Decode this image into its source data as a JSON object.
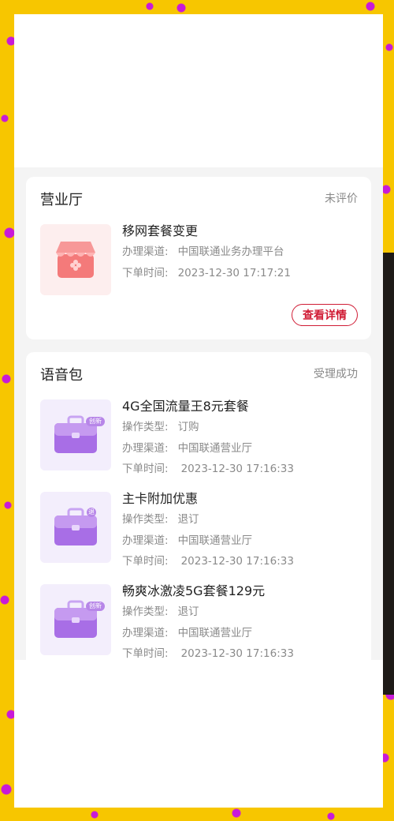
{
  "cards": [
    {
      "title": "营业厅",
      "status": "未评价",
      "item": {
        "icon": "store-icon",
        "name": "移网套餐变更",
        "channel_label": "办理渠道:",
        "channel_value": "中国联通业务办理平台",
        "time_label": "下单时间:",
        "time_value": "2023-12-30 17:17:21"
      },
      "detail_button": "查看详情"
    },
    {
      "title": "语音包",
      "status": "受理成功",
      "items": [
        {
          "icon": "briefcase-icon",
          "badge": "创新",
          "name": "4G全国流量王8元套餐",
          "op_label": "操作类型:",
          "op_value": "订购",
          "channel_label": "办理渠道:",
          "channel_value": "中国联通营业厅",
          "time_label": "下单时间:",
          "time_value": "2023-12-30 17:16:33"
        },
        {
          "icon": "briefcase-icon",
          "badge": "退",
          "name": "主卡附加优惠",
          "op_label": "操作类型:",
          "op_value": "退订",
          "channel_label": "办理渠道:",
          "channel_value": "中国联通营业厅",
          "time_label": "下单时间:",
          "time_value": "2023-12-30 17:16:33"
        },
        {
          "icon": "briefcase-icon",
          "badge": "创新",
          "name": "畅爽冰激凌5G套餐129元",
          "op_label": "操作类型:",
          "op_value": "退订",
          "channel_label": "办理渠道:",
          "channel_value": "中国联通营业厅",
          "time_label": "下单时间:",
          "time_value": "2023-12-30 17:16:33"
        }
      ]
    }
  ],
  "colors": {
    "accent_red": "#d01c35",
    "background_yellow": "#f7c600",
    "dot_magenta": "#c81ad8",
    "icon_purple": "#a86ee6",
    "icon_pink": "#f47a7a"
  }
}
